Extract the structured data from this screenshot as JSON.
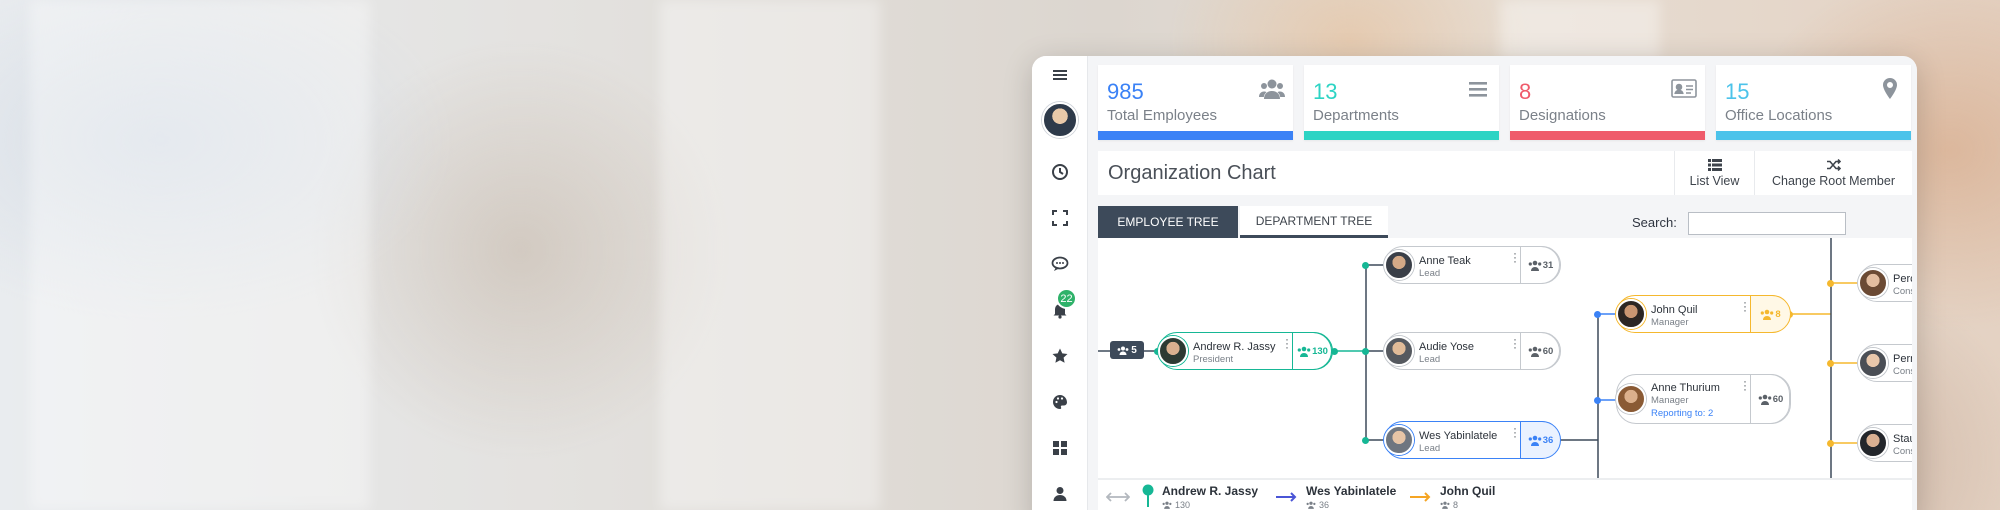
{
  "stats": [
    {
      "value": "985",
      "label": "Total Employees",
      "color": "#3b82f6",
      "icon": "users-icon"
    },
    {
      "value": "13",
      "label": "Departments",
      "color": "#2dd4c4",
      "icon": "list-icon"
    },
    {
      "value": "8",
      "label": "Designations",
      "color": "#ef5b6b",
      "icon": "id-card-icon"
    },
    {
      "value": "15",
      "label": "Office Locations",
      "color": "#4cc3ea",
      "icon": "map-pin-icon"
    }
  ],
  "sidebar": {
    "notification_count": "22"
  },
  "header": {
    "title": "Organization Chart",
    "list_view": "List View",
    "change_root": "Change Root Member"
  },
  "tabs": {
    "employee_tree": "EMPLOYEE TREE",
    "department_tree": "DEPARTMENT TREE"
  },
  "search": {
    "label": "Search:",
    "value": ""
  },
  "tree": {
    "collapsed_count": "5",
    "nodes": [
      {
        "name": "Andrew R. Jassy",
        "role": "President",
        "count": "130",
        "color": "#16b795"
      },
      {
        "name": "Anne Teak",
        "role": "Lead",
        "count": "31",
        "color": "#9aa0a6"
      },
      {
        "name": "Audie Yose",
        "role": "Lead",
        "count": "60",
        "color": "#9aa0a6"
      },
      {
        "name": "Wes Yabinlatele",
        "role": "Lead",
        "count": "36",
        "color": "#3b82f6"
      },
      {
        "name": "John Quil",
        "role": "Manager",
        "count": "8",
        "color": "#f5b82e"
      },
      {
        "name": "Anne Thurium",
        "role": "Manager",
        "reporting": "Reporting to: 2",
        "count": "60",
        "color": "#9aa0a6"
      },
      {
        "name": "Percy",
        "role": "Consu",
        "color": "#9aa0a6"
      },
      {
        "name": "Perry",
        "role": "Consu",
        "color": "#9aa0a6"
      },
      {
        "name": "Staun",
        "role": "Consu",
        "color": "#9aa0a6"
      }
    ]
  },
  "breadcrumb": [
    {
      "name": "Andrew R. Jassy",
      "count": "130",
      "color": "#16b795"
    },
    {
      "name": "Wes Yabinlatele",
      "count": "36",
      "color": "#4a55d6"
    },
    {
      "name": "John Quil",
      "count": "8",
      "color": "#f5a524"
    }
  ]
}
